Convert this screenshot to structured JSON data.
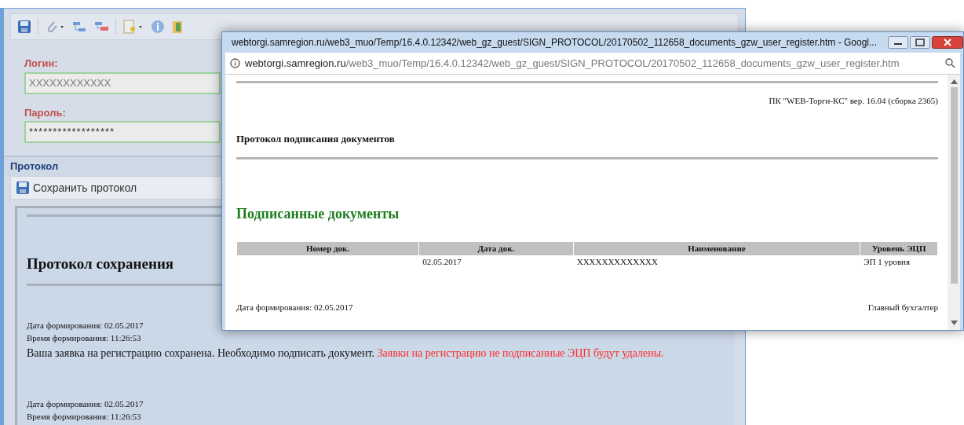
{
  "main_window": {
    "login": {
      "label": "Логин:",
      "value": "XXXXXXXXXXXX"
    },
    "password": {
      "label": "Пароль:",
      "value": "******************"
    },
    "protocol": {
      "title": "Протокол",
      "save_button": "Сохранить протокол",
      "heading": "Протокол сохранения",
      "blocks": [
        {
          "date": "Дата формирования: 02.05.2017",
          "time": "Время формирования: 11:26:53",
          "message": "Ваша заявка на регистрацию сохранена. Необходимо подписать документ.",
          "warning": "Заявки на регистрацию не подписанные ЭЦП будут удалены."
        },
        {
          "date": "Дата формирования: 02.05.2017",
          "time": "Время формирования: 11:26:53"
        }
      ]
    }
  },
  "popup": {
    "title": "webtorgi.samregion.ru/web3_muo/Temp/16.4.0.12342/web_gz_guest/SIGN_PROTOCOL/20170502_112658_documents_gzw_user_register.htm - Googl...",
    "address_host": "webtorgi.samregion.ru",
    "address_path": "/web3_muo/Temp/16.4.0.12342/web_gz_guest/SIGN_PROTOCOL/20170502_112658_documents_gzw_user_register.htm",
    "version": "ПК \"WEB-Торги-КС\" вер. 16.04 (сборка 2365)",
    "heading": "Протокол подписания документов",
    "section": "Подписанные документы",
    "table": {
      "columns": [
        "Номер док.",
        "Дата док.",
        "Наименование",
        "Уровень ЭЦП"
      ],
      "rows": [
        [
          "",
          "02.05.2017",
          "XXXXXXXXXXXXX",
          "ЭП 1 уровня"
        ]
      ]
    },
    "footer_left": "Дата формирования: 02.05.2017",
    "footer_right": "Главный бухгалтер"
  }
}
